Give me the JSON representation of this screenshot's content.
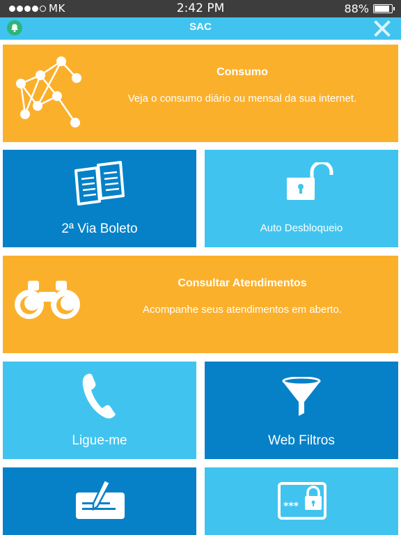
{
  "status_bar": {
    "carrier": "MK",
    "time": "2:42 PM",
    "battery": "88%",
    "battery_level": 0.88
  },
  "nav": {
    "title": "SAC",
    "left_icon": "bell-icon",
    "right_icon": "close-icon"
  },
  "tiles": {
    "consumo": {
      "title": "Consumo",
      "subtitle": "Veja o consumo diário ou mensal da sua internet.",
      "icon": "network-graph-icon",
      "color": "#fbb02c"
    },
    "boleto": {
      "label": "2ª Via Boleto",
      "icon": "documents-icon",
      "color": "#0681c8"
    },
    "desbloqueio": {
      "label": "Auto Desbloqueio",
      "icon": "unlock-icon",
      "color": "#40c4ef"
    },
    "atendimentos": {
      "title": "Consultar Atendimentos",
      "subtitle": "Acompanhe seus atendimentos em aberto.",
      "icon": "binoculars-icon",
      "color": "#fbb02c"
    },
    "ligue": {
      "label": "Ligue-me",
      "icon": "phone-icon",
      "color": "#40c4ef"
    },
    "filtros": {
      "label": "Web Filtros",
      "icon": "funnel-icon",
      "color": "#0681c8"
    },
    "assinatura": {
      "icon": "signature-card-icon",
      "color": "#0681c8"
    },
    "senha": {
      "icon": "password-lock-icon",
      "color": "#40c4ef"
    }
  }
}
